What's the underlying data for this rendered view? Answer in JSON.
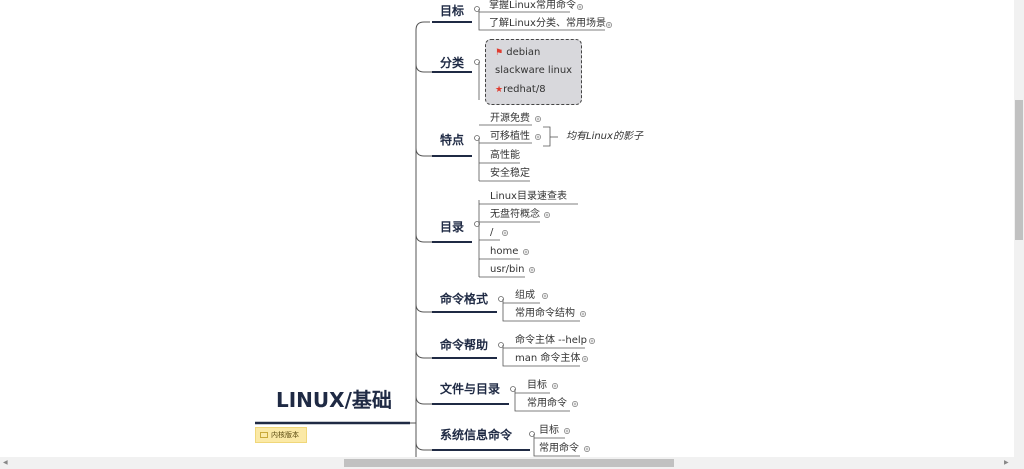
{
  "root": {
    "title": "LINUX/基础",
    "tag_label": "内核版本"
  },
  "branches": {
    "goal": {
      "label": "目标",
      "items": [
        "掌握Linux常用命令",
        "了解Linux分类、常用场景"
      ]
    },
    "category": {
      "label": "分类",
      "items": [
        "debian",
        "slackware linux",
        "redhat/8"
      ]
    },
    "features": {
      "label": "特点",
      "items": [
        "开源免费",
        "可移植性",
        "高性能",
        "安全稳定"
      ],
      "note": "均有Linux的影子"
    },
    "directory": {
      "label": "目录",
      "items": [
        "Linux目录速查表",
        "无盘符概念",
        "/",
        "home",
        "usr/bin"
      ]
    },
    "cmd_format": {
      "label": "命令格式",
      "items": [
        "组成",
        "常用命令结构"
      ]
    },
    "cmd_help": {
      "label": "命令帮助",
      "items": [
        "命令主体 --help",
        "man 命令主体"
      ]
    },
    "files": {
      "label": "文件与目录",
      "items": [
        "目标",
        "常用命令"
      ]
    },
    "sysinfo": {
      "label": "系统信息命令",
      "items": [
        "目标",
        "常用命令"
      ]
    }
  },
  "colors": {
    "branch_line": "#1f2a44",
    "connector": "#555555",
    "flag": "#e03b2f",
    "tag_bg": "#fbe9a6"
  },
  "icons": {
    "flag": "flag-icon",
    "star": "star-icon",
    "expand": "plus-circle-icon",
    "collapse": "minus-circle-icon"
  }
}
